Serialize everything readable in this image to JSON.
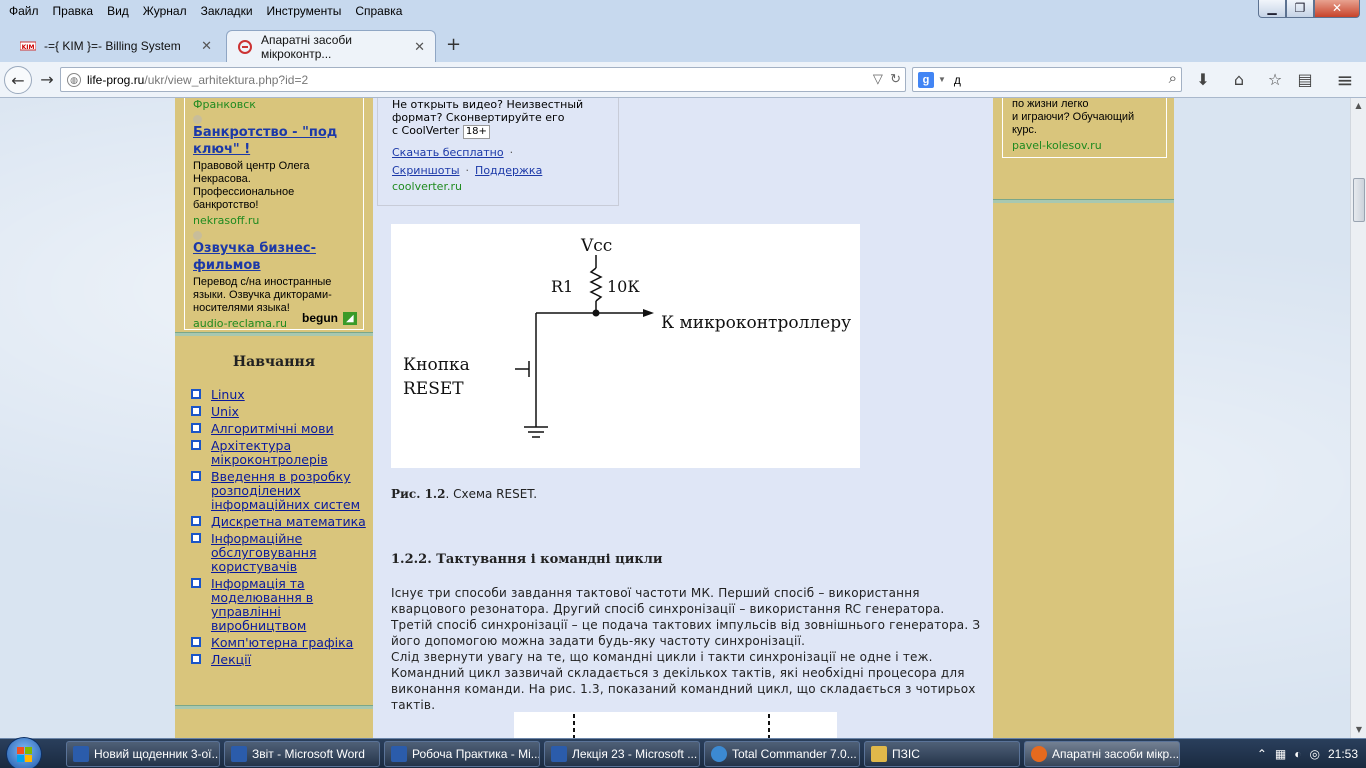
{
  "menu": [
    "Файл",
    "Правка",
    "Вид",
    "Журнал",
    "Закладки",
    "Инструменты",
    "Справка"
  ],
  "tabs": [
    {
      "title": "-={ KIM }=- Billing System",
      "icon_text": "KIM"
    },
    {
      "title": "Апаратні засоби мікроконтр...",
      "active": true
    }
  ],
  "nav": {
    "url_host": "life-prog.ru",
    "url_path": "/ukr/view_arhitektura.php?id=2",
    "search_value": "д",
    "search_engine": "g"
  },
  "left_ads": {
    "partial_host": "Франковск",
    "items": [
      {
        "title": "Банкротство - \"под ключ\" !",
        "desc": "Правовой центр Олега Некрасова. Профессиональное банкротство!",
        "host": "nekrasoff.ru"
      },
      {
        "title": "Озвучка бизнес-фильмов",
        "desc": "Перевод с/на иностранные языки. Озвучка дикторами-носителями языка!",
        "host": "audio-reclama.ru"
      }
    ],
    "brand": "begun"
  },
  "sidebar": {
    "heading": "Навчання",
    "items": [
      "Linux",
      "Unix",
      "Алгоритмічні мови",
      "Архітектура мікроконтролерів",
      "Введення в розробку розподілених інформаційних систем",
      "Дискретна математика",
      "Інформаційне обслуговування користувачів",
      "Інформація та моделювання в управлінні виробництвом",
      "Комп'ютерна графіка",
      "Лекції"
    ]
  },
  "main_ad": {
    "line1": "Не открыть видео? Неизвестный",
    "line2": "формат? Сконвертируйте его",
    "line3": "с CoolVerter",
    "age": "18+",
    "link_download": "Скачать бесплатно",
    "link_screens": "Скриншоты",
    "link_support": "Поддержка",
    "host": "coolverter.ru"
  },
  "figure": {
    "vcc": "Vcc",
    "r1": "R1",
    "r_val": "10К",
    "to_mcu": "К микроконтроллеру",
    "btn_line1": "Кнопка",
    "btn_line2": "RESET"
  },
  "caption": {
    "label": "Рис. 1.2",
    "text": ". Схема RESET."
  },
  "section_title": "1.2.2. Тактування і командні цикли",
  "paragraph1": "Існує три способи завдання тактової частоти МК. Перший спосіб – використання кварцового резонатора. Другий спосіб синхронізації – використання RC генератора. Третій спосіб синхронізації – це подача тактових імпульсів від зовнішнього генератора. З його допомогою можна задати будь-яку частоту синхронізації.",
  "paragraph2": "Слід звернути увагу на те, що командні цикли і такти синхронізації не одне і теж. Командний цикл зазвичай складається з декількох тактів, які необхідні процесора для виконання команди. На рис. 1.3, показаний командний цикл, що складається з чотирьох тактів.",
  "right_ad": {
    "line1": "по жизни легко",
    "line2": "и играючи? Обучающий",
    "line3": "курс.",
    "host": "pavel-kolesov.ru"
  },
  "taskbar": {
    "items": [
      {
        "label": "Новий щоденник 3-ої...",
        "color": "#2b5cab"
      },
      {
        "label": "Звіт - Microsoft Word",
        "color": "#2b5cab"
      },
      {
        "label": "Робоча Практика - Mi...",
        "color": "#2b5cab"
      },
      {
        "label": "Лекція 23 - Microsoft ...",
        "color": "#2b5cab"
      },
      {
        "label": "Total Commander 7.0...",
        "color": "#3c8ad2"
      },
      {
        "label": "ПЗІС",
        "color": "#e0b84a"
      },
      {
        "label": "Апаратні засоби мікр...",
        "color": "#e66a1e",
        "active": true
      }
    ],
    "clock": "21:53"
  }
}
